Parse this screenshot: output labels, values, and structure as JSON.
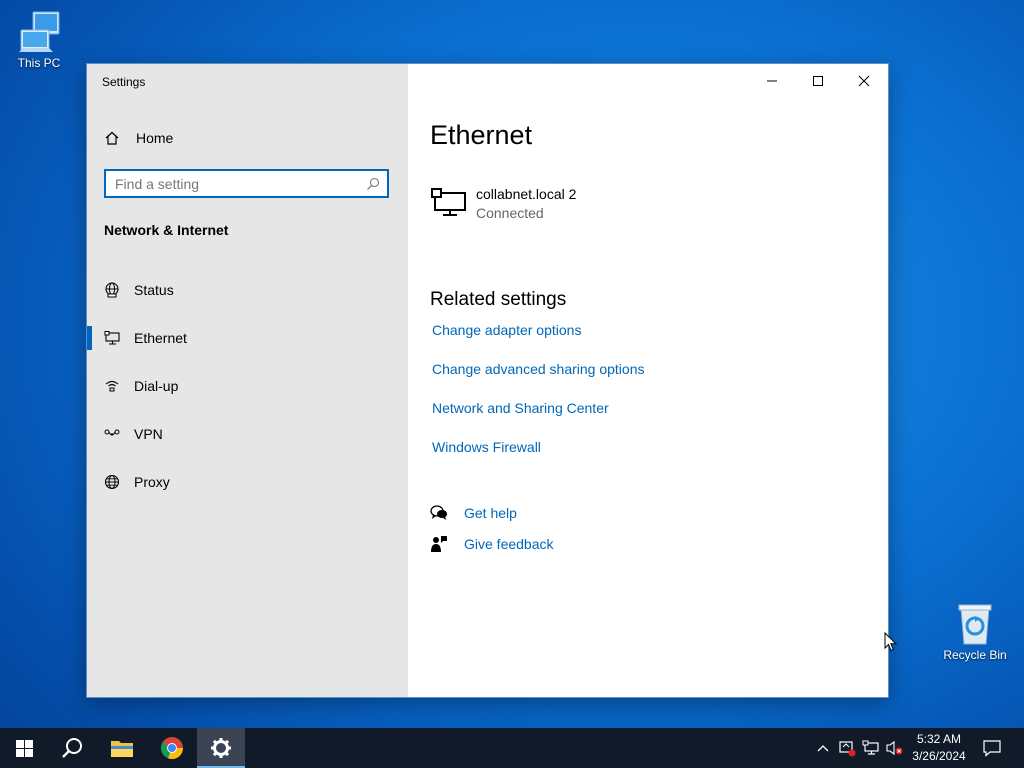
{
  "desktop": {
    "icons": [
      {
        "label": "This PC"
      },
      {
        "label": "Recycle Bin"
      }
    ]
  },
  "window": {
    "title": "Settings",
    "controls": {
      "minimize": "minimize-icon",
      "maximize": "maximize-icon",
      "close": "close-icon"
    }
  },
  "sidebar": {
    "home_label": "Home",
    "search_placeholder": "Find a setting",
    "section_title": "Network & Internet",
    "items": [
      {
        "label": "Status",
        "icon": "status-globe-icon"
      },
      {
        "label": "Ethernet",
        "icon": "ethernet-icon",
        "active": true
      },
      {
        "label": "Dial-up",
        "icon": "dialup-icon"
      },
      {
        "label": "VPN",
        "icon": "vpn-icon"
      },
      {
        "label": "Proxy",
        "icon": "globe-icon"
      }
    ]
  },
  "main": {
    "title": "Ethernet",
    "connection": {
      "name": "collabnet.local 2",
      "status": "Connected",
      "icon": "network-monitor-icon"
    },
    "related_title": "Related settings",
    "links": [
      "Change adapter options",
      "Change advanced sharing options",
      "Network and Sharing Center",
      "Windows Firewall"
    ],
    "help": [
      {
        "label": "Get help",
        "icon": "get-help-icon"
      },
      {
        "label": "Give feedback",
        "icon": "feedback-icon"
      }
    ]
  },
  "taskbar": {
    "apps": [
      "start-icon",
      "search-icon",
      "file-explorer-icon",
      "chrome-icon",
      "settings-gear-icon"
    ],
    "active_app": "settings-gear-icon",
    "clock": {
      "time": "5:32 AM",
      "date": "3/26/2024"
    }
  },
  "colors": {
    "accent": "#0067c0",
    "link": "#0067b8",
    "sidebar_bg": "#e6e6e6",
    "taskbar_bg": "#101a28"
  }
}
